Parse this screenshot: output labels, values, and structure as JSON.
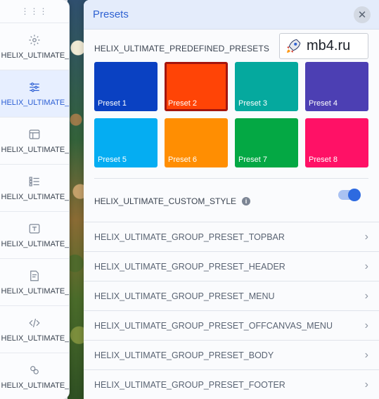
{
  "sidebar": {
    "items": [
      {
        "label": "HELIX_ULTIMATE_BASIC",
        "icon": "gear-icon",
        "active": false
      },
      {
        "label": "HELIX_ULTIMATE_PRES",
        "icon": "sliders-icon",
        "active": true
      },
      {
        "label": "HELIX_ULTIMATE_LAYO",
        "icon": "layout-icon",
        "active": false
      },
      {
        "label": "HELIX_ULTIMATE_NAVI",
        "icon": "list-icon",
        "active": false
      },
      {
        "label": "HELIX_ULTIMATE_TYPO",
        "icon": "typography-icon",
        "active": false
      },
      {
        "label": "HELIX_ULTIMATE_B",
        "icon": "blog-icon",
        "active": false
      },
      {
        "label": "HELIX_ULTIMATE_C",
        "icon": "code-icon",
        "active": false
      },
      {
        "label": "HELIX_ULTIMATE_FI",
        "icon": "settings-advanced-icon",
        "active": false
      }
    ]
  },
  "panel": {
    "title": "Presets",
    "close_icon": "close-icon",
    "predefined_label": "HELIX_ULTIMATE_PREDEFINED_PRESETS",
    "presets": [
      {
        "name": "Preset 1",
        "color": "#0a41c2",
        "selected": false
      },
      {
        "name": "Preset 2",
        "color": "#ff4406",
        "selected": true
      },
      {
        "name": "Preset 3",
        "color": "#05a99e",
        "selected": false
      },
      {
        "name": "Preset 4",
        "color": "#4c3fb3",
        "selected": false
      },
      {
        "name": "Preset 5",
        "color": "#05adf2",
        "selected": false
      },
      {
        "name": "Preset 6",
        "color": "#ff8e02",
        "selected": false
      },
      {
        "name": "Preset 7",
        "color": "#04a844",
        "selected": false
      },
      {
        "name": "Preset 8",
        "color": "#ff1166",
        "selected": false
      }
    ],
    "custom_style_label": "HELIX_ULTIMATE_CUSTOM_STYLE",
    "custom_style_enabled": true,
    "groups": [
      {
        "label": "HELIX_ULTIMATE_GROUP_PRESET_TOPBAR"
      },
      {
        "label": "HELIX_ULTIMATE_GROUP_PRESET_HEADER"
      },
      {
        "label": "HELIX_ULTIMATE_GROUP_PRESET_MENU"
      },
      {
        "label": "HELIX_ULTIMATE_GROUP_PRESET_OFFCANVAS_MENU"
      },
      {
        "label": "HELIX_ULTIMATE_GROUP_PRESET_BODY"
      },
      {
        "label": "HELIX_ULTIMATE_GROUP_PRESET_FOOTER"
      }
    ]
  },
  "watermark": {
    "text": "mb4.ru",
    "icon": "rocket-icon"
  },
  "colors": {
    "accent": "#2f62d2",
    "selected_outline": "#a4150e"
  }
}
